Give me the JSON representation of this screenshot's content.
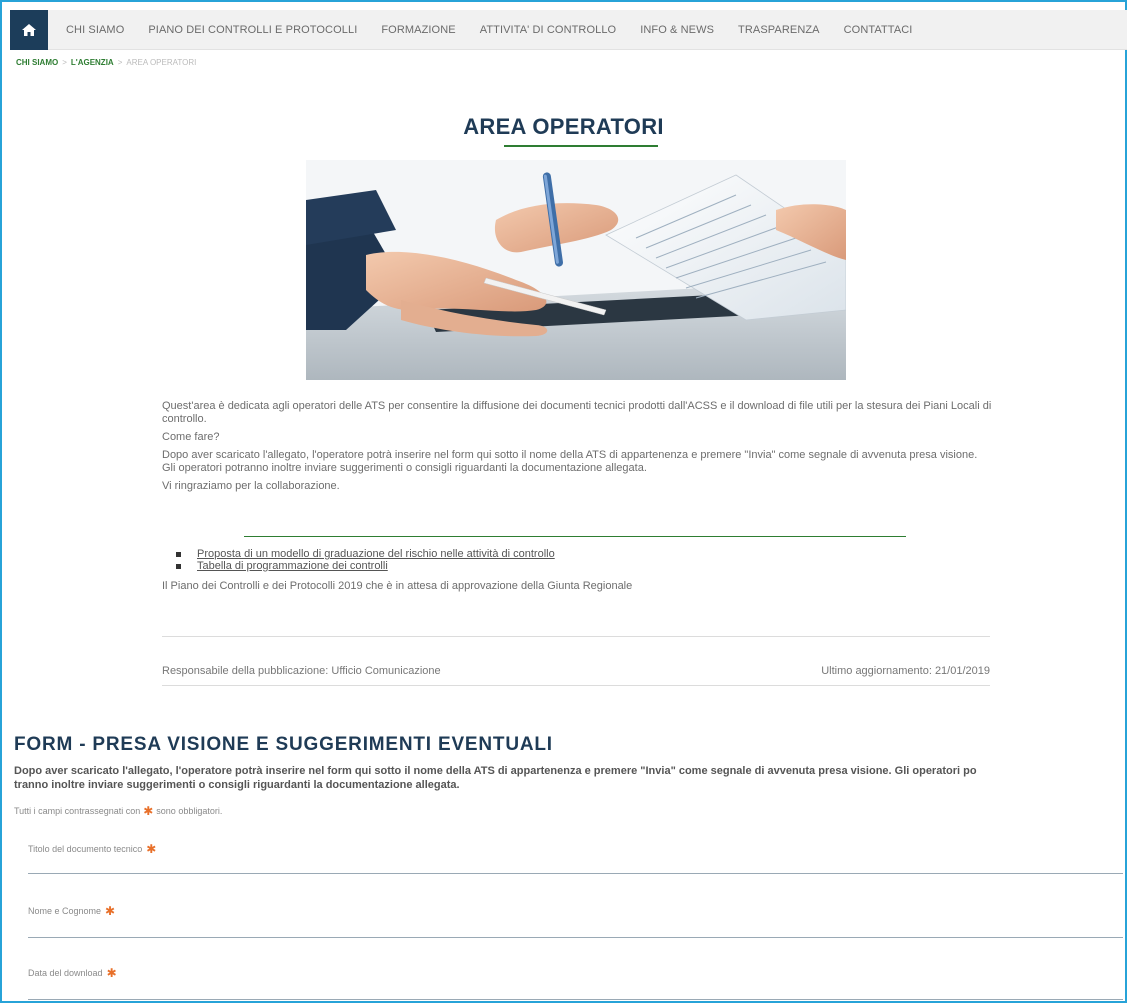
{
  "nav": {
    "home_icon": "home-icon",
    "items": [
      "CHI SIAMO",
      "PIANO DEI CONTROLLI E PROTOCOLLI",
      "FORMAZIONE",
      "ATTIVITA' DI CONTROLLO",
      "INFO & NEWS",
      "TRASPARENZA",
      "CONTATTACI"
    ]
  },
  "breadcrumb": {
    "items": [
      "CHI SIAMO",
      "L'AGENZIA"
    ],
    "separator": ">",
    "current": "AREA OPERATORI"
  },
  "page": {
    "title": "AREA OPERATORI",
    "accent_color": "#2e7d32",
    "title_color": "#1f3b56"
  },
  "intro": {
    "p1": "Quest'area è dedicata agli operatori delle ATS per consentire la diffusione dei documenti tecnici prodotti dall'ACSS e il download di file utili per la stesura dei Piani Locali di controllo.",
    "p2": "Come fare?",
    "p3": "Dopo aver scaricato l'allegato, l'operatore potrà inserire nel form qui sotto il nome della ATS di appartenenza e premere \"Invia\" come segnale di avvenuta presa visione.",
    "p4": "Gli operatori potranno inoltre inviare suggerimenti o consigli riguardanti la documentazione allegata.",
    "p5": "Vi ringraziamo per la collaborazione."
  },
  "documents": [
    "Proposta di un modello di graduazione del rischio nelle attività di controllo",
    "Tabella di programmazione dei controlli"
  ],
  "plan_note": "Il Piano dei Controlli e dei Protocolli 2019 che è in attesa di approvazione della Giunta Regionale",
  "meta": {
    "responsible": "Responsabile della pubblicazione: Ufficio Comunicazione",
    "updated": "Ultimo aggiornamento: 21/01/2019"
  },
  "form": {
    "title": "FORM - PRESA VISIONE E SUGGERIMENTI EVENTUALI",
    "desc_line1": "Dopo aver scaricato l'allegato, l'operatore potrà inserire nel form qui sotto il nome della ATS di appartenenza e premere \"Invia\" come segnale di avvenuta presa visione. Gli operatori po",
    "desc_line2": "tranno inoltre inviare suggerimenti o consigli riguardanti la documentazione allegata.",
    "required_note_before": "Tutti i campi contrassegnati con",
    "required_note_after": "sono obbligatori.",
    "required_mark": "✱",
    "required_color": "#e8702a",
    "fields": [
      {
        "label": "Titolo del documento tecnico",
        "value": ""
      },
      {
        "label": "Nome e Cognome",
        "value": ""
      },
      {
        "label": "Data del download",
        "value": ""
      }
    ]
  }
}
